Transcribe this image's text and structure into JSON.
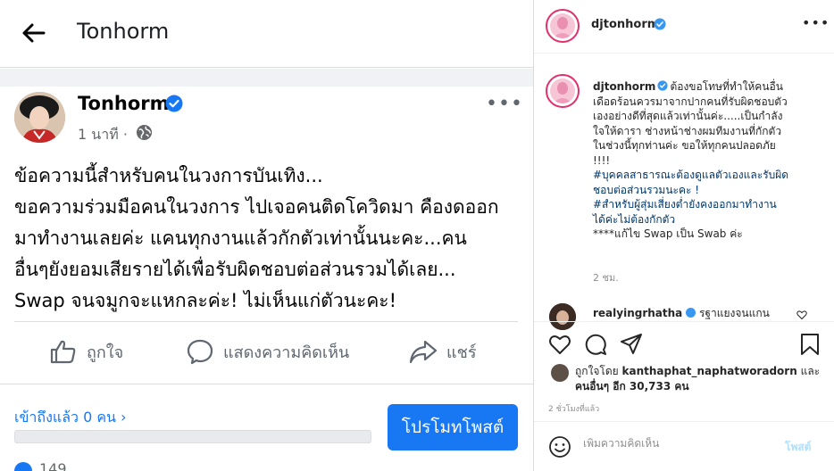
{
  "facebook": {
    "header_title": "Tonhorm",
    "page_name": "Tonhorm",
    "post_time": "1 นาที",
    "more_label": "•••",
    "post_lines": [
      "ข้อความนี้สำหรับคนในวงการบันเทิง...",
      "ขอความร่วมมือคนในวงการ ไปเจอคนติดโควิดมา คืองดออก",
      "มาทำงานเลยค่ะ แคนทุกงานแล้วกักตัวเท่านั้นนะคะ...คน",
      "อื่นๆยังยอมเสียรายได้เพื่อรับผิดชอบต่อส่วนรวมได้เลย...",
      "Swap จนจมูกจะแหกละค่ะ! ไม่เห็นแก่ตัวนะคะ!"
    ],
    "actions": {
      "like": "ถูกใจ",
      "comment": "แสดงความคิดเห็น",
      "share": "แชร์"
    },
    "reach": "เข้าถึงแล้ว 0 คน",
    "promote_button": "โปรโมทโพสต์",
    "reaction_count": "149",
    "colors": {
      "accent": "#1877f2",
      "muted": "#65676b"
    }
  },
  "instagram": {
    "username": "djtonhorm",
    "more_label": "•••",
    "caption": {
      "username": "djtonhorm",
      "lines": [
        "ต้องขอโทษที่ทำให้คนอื่น",
        "เดือดร้อนควรมาจากปากคนที่รับผิดชอบตัว",
        "เองอย่างดีที่สุดแล้วเท่านั้นค่ะ.....เป็นกำลัง",
        "ใจให้ดารา ช่างหน้าช่างผมทีมงานที่กักตัว",
        "ในช่วงนี้ทุกท่านค่ะ ขอให้ทุกคนปลอดภัย",
        "!!!!"
      ],
      "hashtag_lines": [
        "#บุคคลสาธารณะต้องดูแลตัวเองและรับผิด",
        "ชอบต่อส่วนรวมนะคะ !",
        "#สำหรับผู้สุ่มเสี่ยงต่ำยังคงออกมาทำงาน",
        "ได้ค่ะไม่ต้องกักตัว"
      ],
      "note": "****แก้ไข Swap เป็น Swab ค่ะ",
      "time": "2 ชม."
    },
    "comment": {
      "username": "realyingrhatha",
      "text": "รฐาแยงจนแกน"
    },
    "likes": {
      "prefix": "ถูกใจโดย",
      "user": "kanthaphat_naphatworadorn",
      "and": "และ",
      "others": "คนอื่นๆ อีก 30,733 คน"
    },
    "post_time": "2 ชั่วโมงที่แล้ว",
    "comment_placeholder": "เพิ่มความคิดเห็น",
    "post_button": "โพสต์",
    "colors": {
      "hashtag": "#00376b",
      "verified": "#3897f0",
      "post_disabled": "#b2dffc"
    }
  }
}
